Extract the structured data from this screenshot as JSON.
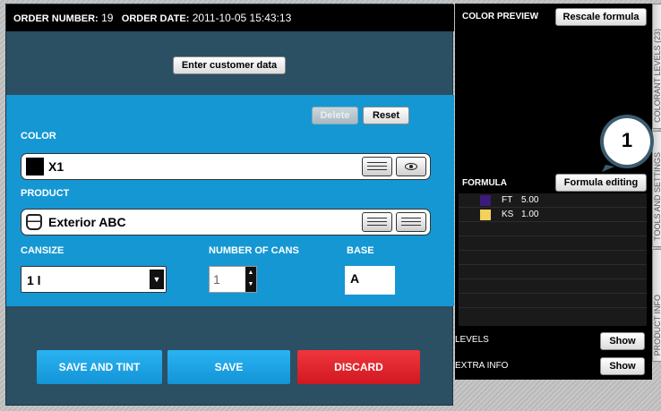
{
  "order": {
    "number_label": "ORDER NUMBER:",
    "number_value": "19",
    "date_label": "ORDER DATE:",
    "date_value": "2011-10-05 15:43:13"
  },
  "customer": {
    "enter_label": "Enter customer data"
  },
  "actions": {
    "delete_label": "Delete",
    "reset_label": "Reset"
  },
  "color": {
    "label": "COLOR",
    "value": "X1",
    "swatch": "#000000"
  },
  "product": {
    "label": "PRODUCT",
    "value": "Exterior ABC"
  },
  "cansize": {
    "label": "CANSIZE",
    "value": "1 l"
  },
  "cans": {
    "label": "NUMBER OF CANS",
    "value": "1"
  },
  "base": {
    "label": "BASE",
    "value": "A"
  },
  "buttons": {
    "save_and_tint": "SAVE AND TINT",
    "save": "SAVE",
    "discard": "DISCARD"
  },
  "preview": {
    "label": "COLOR PREVIEW",
    "rescale_label": "Rescale formula"
  },
  "formula": {
    "label": "FORMULA",
    "editing_label": "Formula editing",
    "rows": [
      {
        "name": "FT",
        "amount": "5.00",
        "color": "#3a1a7a"
      },
      {
        "name": "KS",
        "amount": "1.00",
        "color": "#f2d25a"
      }
    ]
  },
  "levels": {
    "label": "LEVELS",
    "show_label": "Show"
  },
  "extra": {
    "label": "EXTRA INFO",
    "show_label": "Show"
  },
  "side_tabs": {
    "colorant_levels": "COLORANT LEVELS (23)",
    "tools_settings": "TOOLS AND SETTINGS",
    "product_info": "PRODUCT INFO"
  },
  "callout": {
    "number": "1"
  },
  "colors": {
    "panel": "#2b4f63",
    "accent_blue": "#1597d3",
    "save_blue": "#1aa7e8",
    "discard_red": "#e31b23"
  }
}
